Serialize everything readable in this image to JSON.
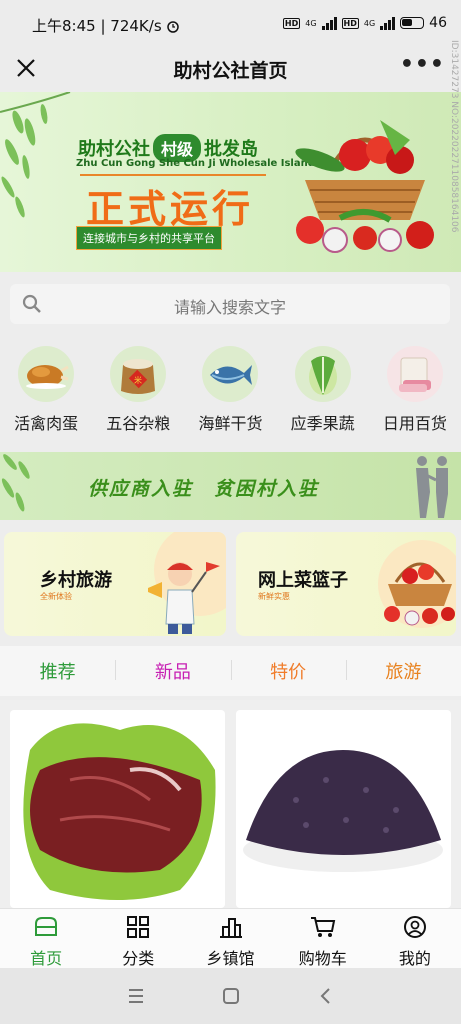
{
  "status_bar": {
    "time": "上午8:45",
    "speed": "724K/s",
    "network_1": "4G",
    "network_2": "4G",
    "battery": "46"
  },
  "title_bar": {
    "title": "助村公社首页",
    "more": "•••"
  },
  "banner": {
    "name_left": "助村公社",
    "name_badge": "村级",
    "name_right": "批发岛",
    "english": "Zhu Cun Gong She Cun Ji Wholesale Island",
    "headline": "正式运行",
    "slogan": "连接城市与乡村的共享平台"
  },
  "search": {
    "placeholder": "请输入搜索文字"
  },
  "categories": [
    {
      "label": "活禽肉蛋",
      "icon": "roast-chicken-icon"
    },
    {
      "label": "五谷杂粮",
      "icon": "grain-sack-icon"
    },
    {
      "label": "海鲜干货",
      "icon": "fish-icon"
    },
    {
      "label": "应季果蔬",
      "icon": "cabbage-icon"
    },
    {
      "label": "日用百货",
      "icon": "towel-icon"
    }
  ],
  "supplier_banner": {
    "text": "供应商入驻　贫困村入驻"
  },
  "feature_cards": [
    {
      "title": "乡村旅游",
      "subtitle": "全新体验"
    },
    {
      "title": "网上菜篮子",
      "subtitle": "新鲜实惠"
    }
  ],
  "tabs": [
    {
      "label": "推荐",
      "color": "#2e9b3a"
    },
    {
      "label": "新品",
      "color": "#c71fb3"
    },
    {
      "label": "特价",
      "color": "#f07c2a"
    },
    {
      "label": "旅游",
      "color": "#e8821f"
    }
  ],
  "bottom_nav": [
    {
      "label": "首页",
      "active": true,
      "color": "#2e9b3a"
    },
    {
      "label": "分类"
    },
    {
      "label": "乡镇馆"
    },
    {
      "label": "购物车"
    },
    {
      "label": "我的"
    }
  ],
  "watermark": "ID:31427273 NO:20220227110858164106"
}
